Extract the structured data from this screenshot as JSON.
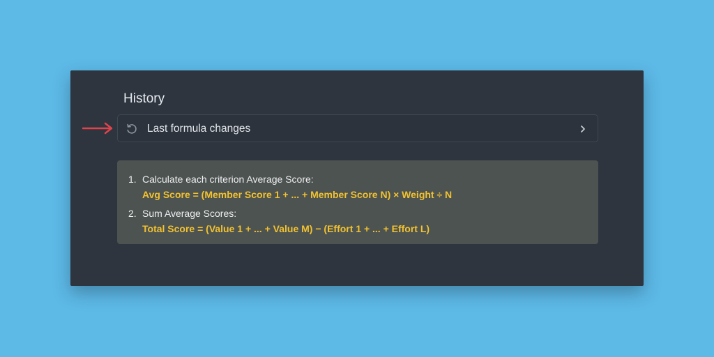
{
  "history": {
    "title": "History",
    "row_label": "Last formula changes",
    "row_icon": "history-icon",
    "chevron_icon": "chevron-right-icon",
    "arrow_icon": "red-arrow-icon",
    "arrow_color": "#e0434b"
  },
  "formula": {
    "steps": [
      {
        "number": "1.",
        "text": "Calculate each criterion Average Score:",
        "formula": "Avg Score = (Member Score 1 + ... + Member Score N) × Weight ÷ N"
      },
      {
        "number": "2.",
        "text": "Sum Average Scores:",
        "formula": "Total Score = (Value 1 + ... + Value M) − (Effort 1 + ... + Effort L)"
      }
    ],
    "highlight_color": "#f2c230"
  }
}
